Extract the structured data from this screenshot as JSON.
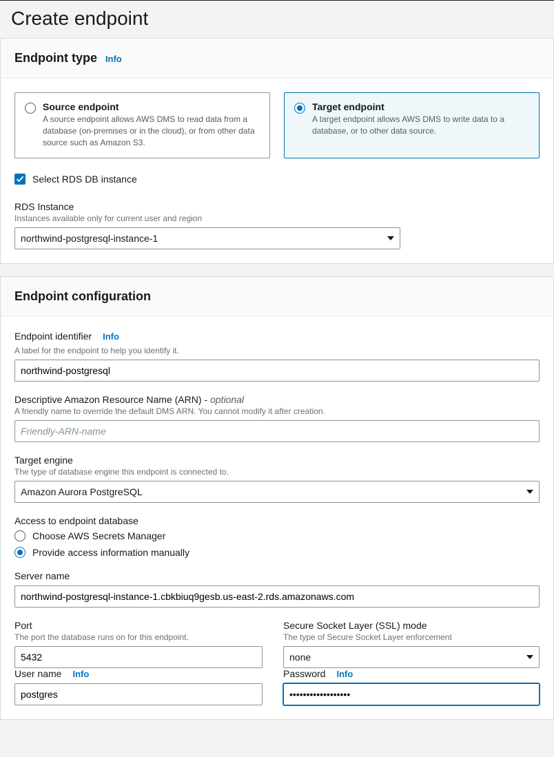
{
  "page_title": "Create endpoint",
  "info_label": "Info",
  "endpoint_type": {
    "heading": "Endpoint type",
    "source": {
      "title": "Source endpoint",
      "desc": "A source endpoint allows AWS DMS to read data from a database (on-premises or in the cloud), or from other data source such as Amazon S3."
    },
    "target": {
      "title": "Target endpoint",
      "desc": "A target endpoint allows AWS DMS to write data to a database, or to other data source."
    },
    "rds_checkbox_label": "Select RDS DB instance",
    "rds_instance": {
      "label": "RDS Instance",
      "hint": "Instances available only for current user and region",
      "value": "northwind-postgresql-instance-1"
    }
  },
  "endpoint_config": {
    "heading": "Endpoint configuration",
    "identifier": {
      "label": "Endpoint identifier",
      "hint": "A label for the endpoint to help you identify it.",
      "value": "northwind-postgresql"
    },
    "arn": {
      "label": "Descriptive Amazon Resource Name (ARN) - ",
      "optional": "optional",
      "hint": "A friendly name to override the default DMS ARN. You cannot modify it after creation.",
      "placeholder": "Friendly-ARN-name",
      "value": ""
    },
    "target_engine": {
      "label": "Target engine",
      "hint": "The type of database engine this endpoint is connected to.",
      "value": "Amazon Aurora PostgreSQL"
    },
    "access": {
      "label": "Access to endpoint database",
      "option_secrets": "Choose AWS Secrets Manager",
      "option_manual": "Provide access information manually"
    },
    "server_name": {
      "label": "Server name",
      "value": "northwind-postgresql-instance-1.cbkbiuq9gesb.us-east-2.rds.amazonaws.com"
    },
    "port": {
      "label": "Port",
      "hint": "The port the database runs on for this endpoint.",
      "value": "5432"
    },
    "ssl": {
      "label": "Secure Socket Layer (SSL) mode",
      "hint": "The type of Secure Socket Layer enforcement",
      "value": "none"
    },
    "username": {
      "label": "User name",
      "value": "postgres"
    },
    "password": {
      "label": "Password",
      "value": "••••••••••••••••••"
    }
  }
}
